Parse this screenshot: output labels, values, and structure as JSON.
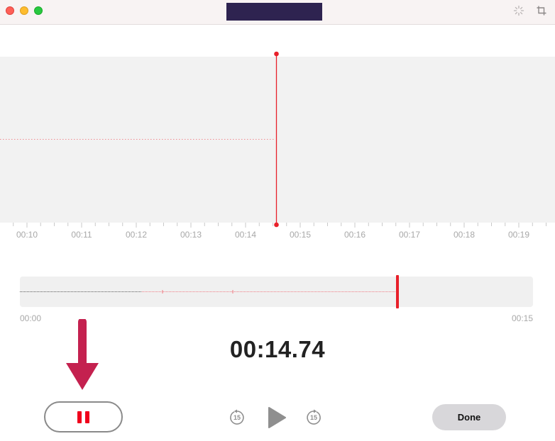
{
  "window": {
    "traffic_lights": [
      "close",
      "minimize",
      "zoom"
    ],
    "toolbar_icons": [
      "enhance-icon",
      "trim-icon"
    ]
  },
  "waveform": {
    "timeline_labels": [
      "00:10",
      "00:11",
      "00:12",
      "00:13",
      "00:14",
      "00:15",
      "00:16",
      "00:17",
      "00:18",
      "00:19"
    ],
    "playhead_color": "#e8202a"
  },
  "overview": {
    "start_label": "00:00",
    "end_label": "00:15",
    "progress_fraction": 0.736
  },
  "playback": {
    "current_time": "00:14.74",
    "skip_back_label": "15",
    "skip_forward_label": "15",
    "done_label": "Done"
  },
  "colors": {
    "accent_red": "#f0001c",
    "annotation_arrow": "#c4214f"
  }
}
